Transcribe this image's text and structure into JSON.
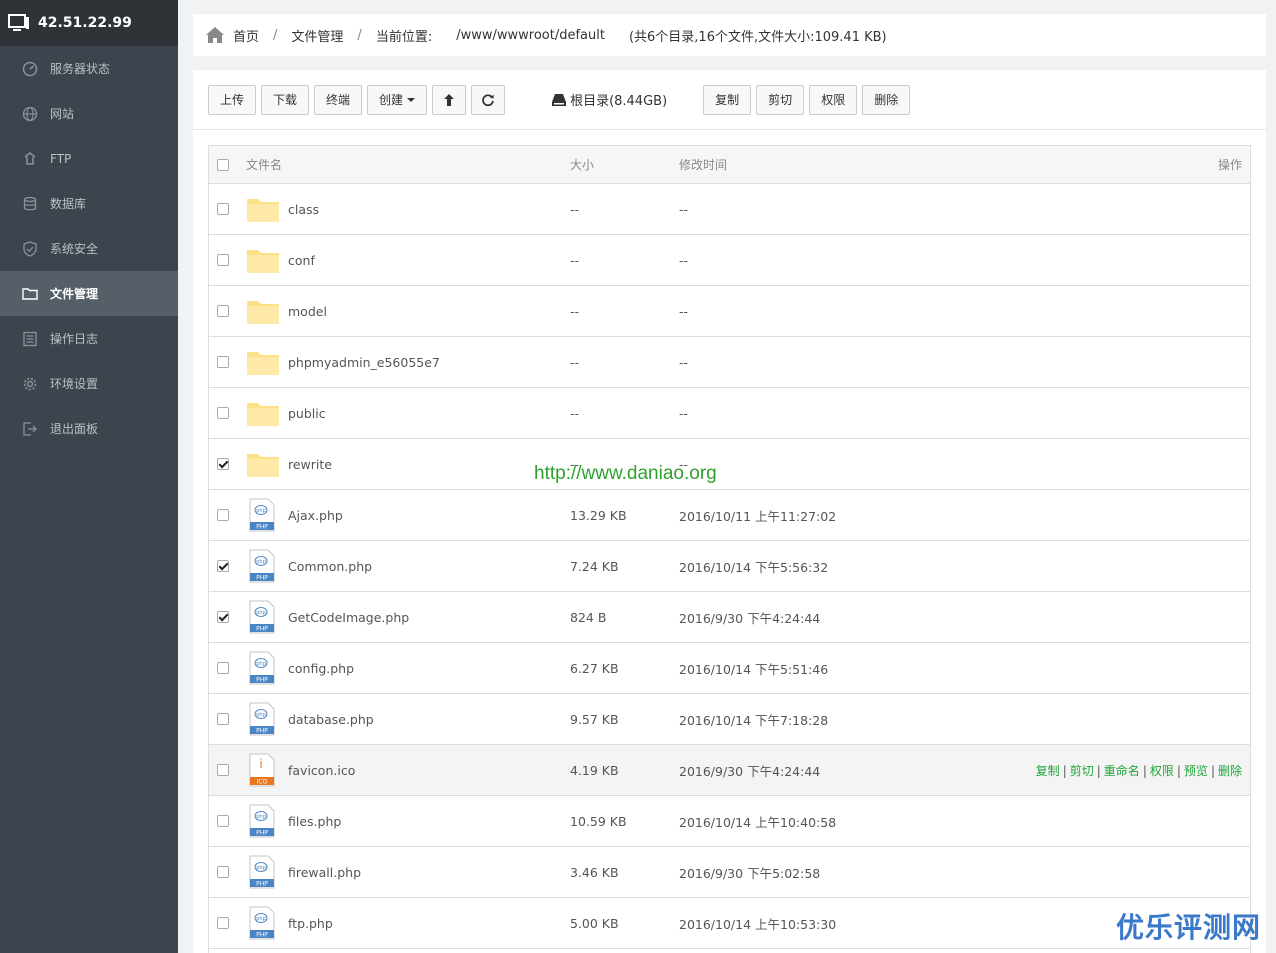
{
  "sidebar": {
    "ip": "42.51.22.99",
    "items": [
      {
        "label": "服务器状态",
        "icon": "dashboard-icon"
      },
      {
        "label": "网站",
        "icon": "globe-icon"
      },
      {
        "label": "FTP",
        "icon": "ftp-icon"
      },
      {
        "label": "数据库",
        "icon": "database-icon"
      },
      {
        "label": "系统安全",
        "icon": "shield-icon"
      },
      {
        "label": "文件管理",
        "icon": "folder-icon",
        "active": true
      },
      {
        "label": "操作日志",
        "icon": "log-icon"
      },
      {
        "label": "环境设置",
        "icon": "gear-icon"
      },
      {
        "label": "退出面板",
        "icon": "logout-icon"
      }
    ]
  },
  "breadcrumb": {
    "home": "首页",
    "section": "文件管理",
    "location_label": "当前位置:",
    "path": "/www/wwwroot/default",
    "summary": "(共6个目录,16个文件,文件大小:109.41 KB)"
  },
  "toolbar": {
    "upload": "上传",
    "download": "下载",
    "terminal": "终端",
    "create": "创建",
    "disk": "根目录(8.44GB)",
    "copy": "复制",
    "cut": "剪切",
    "permission": "权限",
    "delete": "删除"
  },
  "table": {
    "headers": {
      "name": "文件名",
      "size": "大小",
      "time": "修改时间",
      "op": "操作"
    },
    "rows": [
      {
        "name": "class",
        "type": "folder",
        "size": "--",
        "time": "--",
        "checked": false
      },
      {
        "name": "conf",
        "type": "folder",
        "size": "--",
        "time": "--",
        "checked": false
      },
      {
        "name": "model",
        "type": "folder",
        "size": "--",
        "time": "--",
        "checked": false
      },
      {
        "name": "phpmyadmin_e56055e7",
        "type": "folder",
        "size": "--",
        "time": "--",
        "checked": false
      },
      {
        "name": "public",
        "type": "folder",
        "size": "--",
        "time": "--",
        "checked": false
      },
      {
        "name": "rewrite",
        "type": "folder",
        "size": "--",
        "time": "--",
        "checked": true
      },
      {
        "name": "Ajax.php",
        "type": "php",
        "size": "13.29 KB",
        "time": "2016/10/11 上午11:27:02",
        "checked": false
      },
      {
        "name": "Common.php",
        "type": "php",
        "size": "7.24 KB",
        "time": "2016/10/14 下午5:56:32",
        "checked": true
      },
      {
        "name": "GetCodeImage.php",
        "type": "php",
        "size": "824 B",
        "time": "2016/9/30 下午4:24:44",
        "checked": true
      },
      {
        "name": "config.php",
        "type": "php",
        "size": "6.27 KB",
        "time": "2016/10/14 下午5:51:46",
        "checked": false
      },
      {
        "name": "database.php",
        "type": "php",
        "size": "9.57 KB",
        "time": "2016/10/14 下午7:18:28",
        "checked": false
      },
      {
        "name": "favicon.ico",
        "type": "ico",
        "size": "4.19 KB",
        "time": "2016/9/30 下午4:24:44",
        "checked": false,
        "hover": true
      },
      {
        "name": "files.php",
        "type": "php",
        "size": "10.59 KB",
        "time": "2016/10/14 上午10:40:58",
        "checked": false
      },
      {
        "name": "firewall.php",
        "type": "php",
        "size": "3.46 KB",
        "time": "2016/9/30 下午5:02:58",
        "checked": false
      },
      {
        "name": "ftp.php",
        "type": "php",
        "size": "5.00 KB",
        "time": "2016/10/14 上午10:53:30",
        "checked": false
      }
    ],
    "row_actions": [
      "复制",
      "剪切",
      "重命名",
      "权限",
      "预览",
      "删除"
    ]
  },
  "icon_labels": {
    "php": "PHP",
    "ico": "ICO"
  },
  "watermark": "http://www.daniao.org",
  "corner_logo": "优乐评测网",
  "colors": {
    "sidebar_bg": "#3c444d",
    "accent_green": "#20a53a",
    "folder_yellow": "#fde187",
    "php_blue": "#4a86c5",
    "ico_orange": "#e87722"
  }
}
